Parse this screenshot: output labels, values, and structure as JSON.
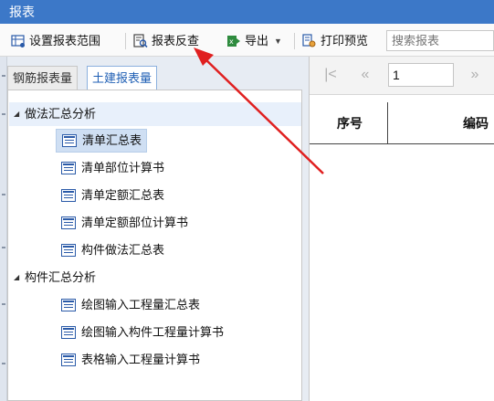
{
  "window": {
    "title": "报表"
  },
  "toolbar": {
    "set_range_label": "设置报表范围",
    "reverse_lookup_label": "报表反查",
    "export_label": "导出",
    "print_preview_label": "打印预览",
    "search_placeholder": "搜索报表"
  },
  "tabs": [
    {
      "label": "钢筋报表量",
      "active": false
    },
    {
      "label": "土建报表量",
      "active": true
    }
  ],
  "tree": {
    "groups": [
      {
        "label": "做法汇总分析",
        "expanded": true,
        "items": [
          {
            "label": "清单汇总表",
            "selected": true
          },
          {
            "label": "清单部位计算书",
            "selected": false
          },
          {
            "label": "清单定额汇总表",
            "selected": false
          },
          {
            "label": "清单定额部位计算书",
            "selected": false
          },
          {
            "label": "构件做法汇总表",
            "selected": false
          }
        ]
      },
      {
        "label": "构件汇总分析",
        "expanded": true,
        "items": [
          {
            "label": "绘图输入工程量汇总表",
            "selected": false
          },
          {
            "label": "绘图输入构件工程量计算书",
            "selected": false
          },
          {
            "label": "表格输入工程量计算书",
            "selected": false
          }
        ]
      }
    ]
  },
  "pager": {
    "page_value": "1"
  },
  "table": {
    "columns": [
      "序号",
      "编码"
    ]
  },
  "colors": {
    "title_bar": "#3c78c8",
    "accent": "#1f5fb4",
    "annotation_arrow": "#e02020"
  }
}
